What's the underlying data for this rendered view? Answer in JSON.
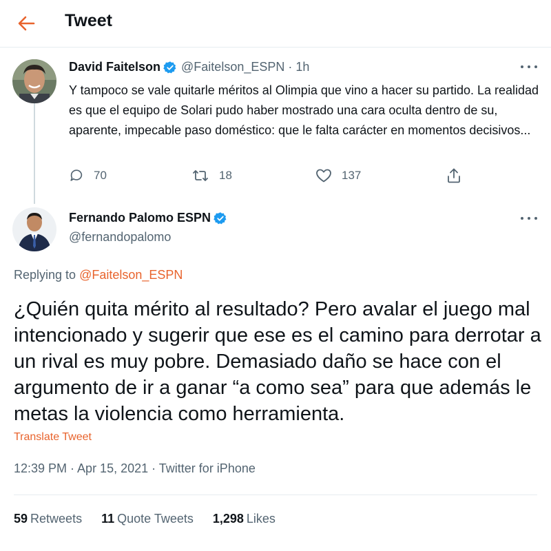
{
  "header": {
    "title": "Tweet"
  },
  "quoted_tweet": {
    "author_name": "David Faitelson",
    "handle": "@Faitelson_ESPN",
    "time": "1h",
    "text": "Y tampoco se vale quitarle méritos al Olimpia que vino a hacer su partido. La realidad es que el equipo de Solari pudo haber mostrado una cara oculta dentro de su, aparente, impecable paso doméstico: que le falta carácter en momentos decisivos...",
    "replies": "70",
    "retweets": "18",
    "likes": "137"
  },
  "main_tweet": {
    "author_name": "Fernando Palomo ESPN",
    "handle": "@fernandopalomo",
    "replying_prefix": "Replying to",
    "replying_to": "@Faitelson_ESPN",
    "text": "¿Quién quita mérito al resultado? Pero avalar el juego mal intencionado y sugerir que ese es el camino para derrotar a un rival es muy pobre. Demasiado daño se hace con el argumento de ir a ganar “a como sea” para que además le metas la violencia como herramienta.",
    "translate_label": "Translate Tweet",
    "timestamp": "12:39 PM · Apr 15, 2021 · Twitter for iPhone"
  },
  "stats": {
    "retweets_count": "59",
    "retweets_label": "Retweets",
    "quotes_count": "11",
    "quotes_label": "Quote Tweets",
    "likes_count": "1,298",
    "likes_label": "Likes"
  },
  "colors": {
    "accent": "#e8632c",
    "verified": "#1d9bf0",
    "secondary_text": "#536471",
    "divider": "#e6ecf0"
  },
  "icons": [
    "back-arrow-icon",
    "verified-badge-icon",
    "more-icon",
    "reply-icon",
    "retweet-icon",
    "like-icon",
    "share-icon"
  ]
}
